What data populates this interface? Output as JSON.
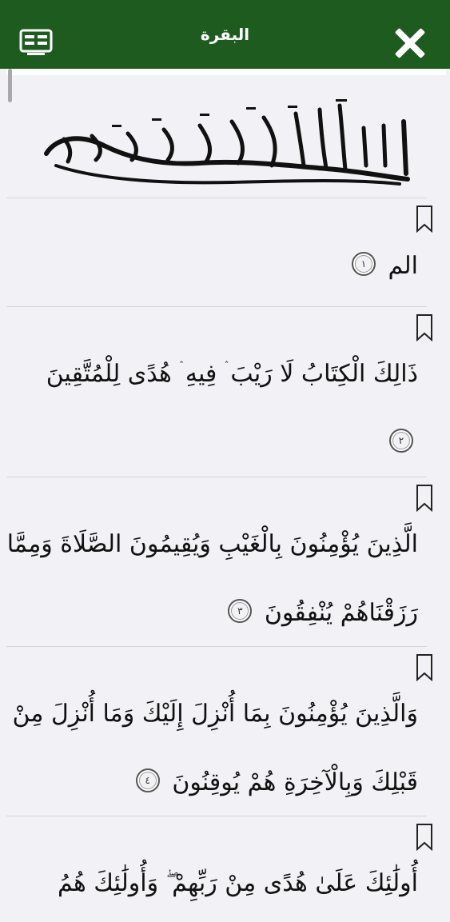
{
  "header": {
    "title": "البقرة",
    "menu_icon": "list-view-icon",
    "close_icon": "close-icon",
    "background_color": "#1e5b1f"
  },
  "basmala": {
    "text": "بسم الله الرحمن الرحيم"
  },
  "verses": [
    {
      "lines": [
        "الم"
      ],
      "marker": "١"
    },
    {
      "lines": [
        "ذَالِكَ الْكِتَابُ لَا رَيْبَ ۛ فِيهِ ۛ هُدًى لِلْمُتَّقِينَ",
        ""
      ],
      "marker": "٢"
    },
    {
      "lines": [
        "الَّذِينَ يُؤْمِنُونَ بِالْغَيْبِ وَيُقِيمُونَ الصَّلَاةَ وَمِمَّا",
        "رَزَقْنَاهُمْ يُنْفِقُونَ"
      ],
      "marker": "٣"
    },
    {
      "lines": [
        "وَالَّذِينَ يُؤْمِنُونَ بِمَا أُنْزِلَ إِلَيْكَ وَمَا أُنْزِلَ مِنْ",
        "قَبْلِكَ وَبِالْآخِرَةِ هُمْ يُوقِنُونَ"
      ],
      "marker": "٤"
    },
    {
      "lines": [
        "أُولَٰئِكَ عَلَىٰ هُدًى مِنْ رَبِّهِمْ ۖ وَأُولَٰئِكَ هُمُ"
      ],
      "marker": ""
    }
  ]
}
